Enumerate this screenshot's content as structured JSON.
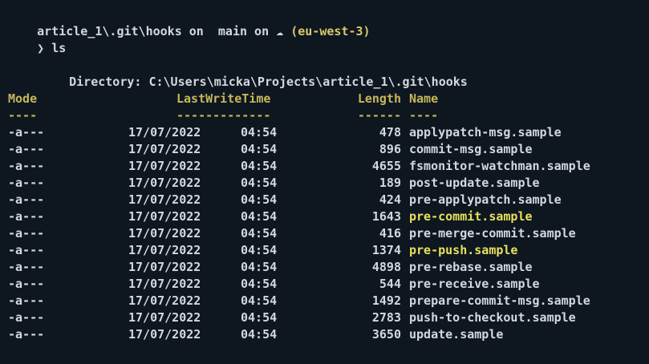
{
  "prompt": {
    "path": "article_1\\.git\\hooks",
    "on1": " on ",
    "branch_glyph": "",
    "branch": " main",
    "on2": " on ",
    "cloud_glyph": "☁",
    "region": "(eu-west-3)"
  },
  "command": {
    "chevron": "❯",
    "text": "ls"
  },
  "directory": {
    "label": "Directory:",
    "path": "C:\\Users\\micka\\Projects\\article_1\\.git\\hooks"
  },
  "table": {
    "headers": {
      "mode": "Mode",
      "lastwrite": "LastWriteTime",
      "length": "Length",
      "name": "Name"
    },
    "underlines": {
      "mode": "----",
      "lastwrite": "-------------",
      "length": "------",
      "name": "----"
    },
    "rows": [
      {
        "mode": "-a---",
        "date": "17/07/2022",
        "time": "04:54",
        "length": "478",
        "name": "applypatch-msg.sample",
        "highlight": false
      },
      {
        "mode": "-a---",
        "date": "17/07/2022",
        "time": "04:54",
        "length": "896",
        "name": "commit-msg.sample",
        "highlight": false
      },
      {
        "mode": "-a---",
        "date": "17/07/2022",
        "time": "04:54",
        "length": "4655",
        "name": "fsmonitor-watchman.sample",
        "highlight": false
      },
      {
        "mode": "-a---",
        "date": "17/07/2022",
        "time": "04:54",
        "length": "189",
        "name": "post-update.sample",
        "highlight": false
      },
      {
        "mode": "-a---",
        "date": "17/07/2022",
        "time": "04:54",
        "length": "424",
        "name": "pre-applypatch.sample",
        "highlight": false
      },
      {
        "mode": "-a---",
        "date": "17/07/2022",
        "time": "04:54",
        "length": "1643",
        "name": "pre-commit.sample",
        "highlight": true
      },
      {
        "mode": "-a---",
        "date": "17/07/2022",
        "time": "04:54",
        "length": "416",
        "name": "pre-merge-commit.sample",
        "highlight": false
      },
      {
        "mode": "-a---",
        "date": "17/07/2022",
        "time": "04:54",
        "length": "1374",
        "name": "pre-push.sample",
        "highlight": true
      },
      {
        "mode": "-a---",
        "date": "17/07/2022",
        "time": "04:54",
        "length": "4898",
        "name": "pre-rebase.sample",
        "highlight": false
      },
      {
        "mode": "-a---",
        "date": "17/07/2022",
        "time": "04:54",
        "length": "544",
        "name": "pre-receive.sample",
        "highlight": false
      },
      {
        "mode": "-a---",
        "date": "17/07/2022",
        "time": "04:54",
        "length": "1492",
        "name": "prepare-commit-msg.sample",
        "highlight": false
      },
      {
        "mode": "-a---",
        "date": "17/07/2022",
        "time": "04:54",
        "length": "2783",
        "name": "push-to-checkout.sample",
        "highlight": false
      },
      {
        "mode": "-a---",
        "date": "17/07/2022",
        "time": "04:54",
        "length": "3650",
        "name": "update.sample",
        "highlight": false
      }
    ]
  },
  "colors": {
    "background": "#0e1620",
    "text": "#d4d8dd",
    "header": "#c8b75a",
    "highlight": "#e6e15a",
    "region": "#d8c86a"
  }
}
